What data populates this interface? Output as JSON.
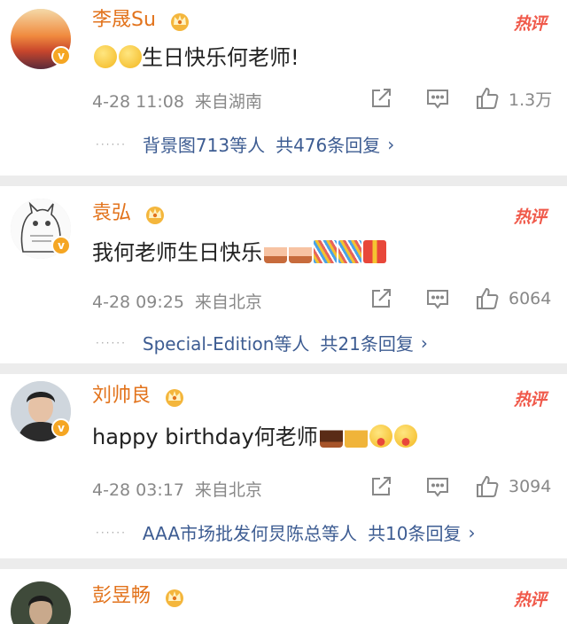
{
  "comments": [
    {
      "author": "李晟Su",
      "hot_label": "热评",
      "text": "生日快乐何老师!",
      "emoji_before": [
        "face-emoji",
        "face-emoji"
      ],
      "emoji_after": [],
      "date": "4-28 11:08",
      "location": "来自湖南",
      "likes": "1.3万",
      "reply_user": "背景图713等人",
      "reply_total": "共476条回复"
    },
    {
      "author": "袁弘",
      "hot_label": "热评",
      "text": "我何老师生日快乐",
      "emoji_before": [],
      "emoji_after": [
        "cake-emoji",
        "cake-emoji",
        "confetti-emoji",
        "confetti-emoji",
        "gift-emoji"
      ],
      "date": "4-28 09:25",
      "location": "来自北京",
      "likes": "6064",
      "reply_user": "Special-Edition等人",
      "reply_total": "共21条回复"
    },
    {
      "author": "刘帅良",
      "hot_label": "热评",
      "text": "happy birthday何老师",
      "emoji_before": [],
      "emoji_after": [
        "cake-emoji",
        "cheers-emoji",
        "tongue-emoji",
        "tongue-emoji"
      ],
      "date": "4-28 03:17",
      "location": "来自北京",
      "likes": "3094",
      "reply_user": "AAA市场批发何炅陈总等人",
      "reply_total": "共10条回复"
    },
    {
      "author": "彭昱畅",
      "hot_label": "热评"
    }
  ],
  "colors": {
    "author": "#e2731c",
    "hot": "#f05a4b",
    "reply_link": "#3d5c92",
    "meta": "#888888"
  }
}
